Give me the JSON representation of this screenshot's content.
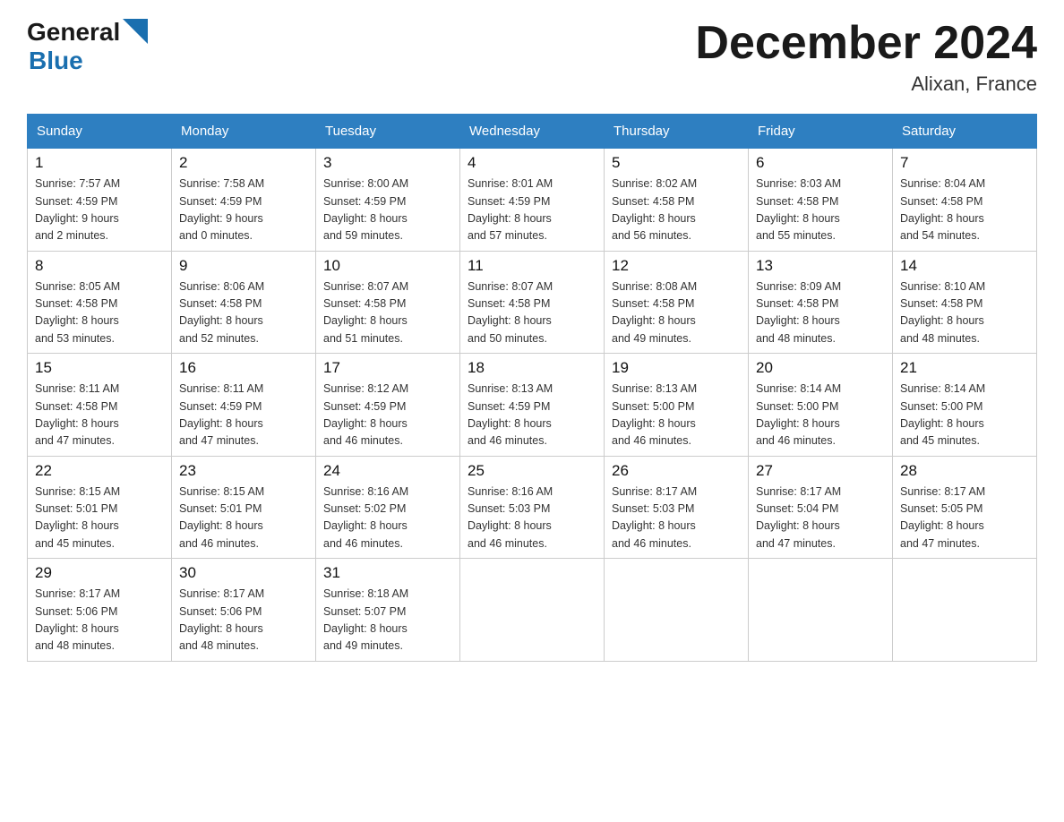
{
  "logo": {
    "general": "General",
    "blue": "Blue"
  },
  "title": "December 2024",
  "location": "Alixan, France",
  "days_of_week": [
    "Sunday",
    "Monday",
    "Tuesday",
    "Wednesday",
    "Thursday",
    "Friday",
    "Saturday"
  ],
  "weeks": [
    [
      {
        "num": "1",
        "sunrise": "7:57 AM",
        "sunset": "4:59 PM",
        "daylight": "9 hours and 2 minutes."
      },
      {
        "num": "2",
        "sunrise": "7:58 AM",
        "sunset": "4:59 PM",
        "daylight": "9 hours and 0 minutes."
      },
      {
        "num": "3",
        "sunrise": "8:00 AM",
        "sunset": "4:59 PM",
        "daylight": "8 hours and 59 minutes."
      },
      {
        "num": "4",
        "sunrise": "8:01 AM",
        "sunset": "4:59 PM",
        "daylight": "8 hours and 57 minutes."
      },
      {
        "num": "5",
        "sunrise": "8:02 AM",
        "sunset": "4:58 PM",
        "daylight": "8 hours and 56 minutes."
      },
      {
        "num": "6",
        "sunrise": "8:03 AM",
        "sunset": "4:58 PM",
        "daylight": "8 hours and 55 minutes."
      },
      {
        "num": "7",
        "sunrise": "8:04 AM",
        "sunset": "4:58 PM",
        "daylight": "8 hours and 54 minutes."
      }
    ],
    [
      {
        "num": "8",
        "sunrise": "8:05 AM",
        "sunset": "4:58 PM",
        "daylight": "8 hours and 53 minutes."
      },
      {
        "num": "9",
        "sunrise": "8:06 AM",
        "sunset": "4:58 PM",
        "daylight": "8 hours and 52 minutes."
      },
      {
        "num": "10",
        "sunrise": "8:07 AM",
        "sunset": "4:58 PM",
        "daylight": "8 hours and 51 minutes."
      },
      {
        "num": "11",
        "sunrise": "8:07 AM",
        "sunset": "4:58 PM",
        "daylight": "8 hours and 50 minutes."
      },
      {
        "num": "12",
        "sunrise": "8:08 AM",
        "sunset": "4:58 PM",
        "daylight": "8 hours and 49 minutes."
      },
      {
        "num": "13",
        "sunrise": "8:09 AM",
        "sunset": "4:58 PM",
        "daylight": "8 hours and 48 minutes."
      },
      {
        "num": "14",
        "sunrise": "8:10 AM",
        "sunset": "4:58 PM",
        "daylight": "8 hours and 48 minutes."
      }
    ],
    [
      {
        "num": "15",
        "sunrise": "8:11 AM",
        "sunset": "4:58 PM",
        "daylight": "8 hours and 47 minutes."
      },
      {
        "num": "16",
        "sunrise": "8:11 AM",
        "sunset": "4:59 PM",
        "daylight": "8 hours and 47 minutes."
      },
      {
        "num": "17",
        "sunrise": "8:12 AM",
        "sunset": "4:59 PM",
        "daylight": "8 hours and 46 minutes."
      },
      {
        "num": "18",
        "sunrise": "8:13 AM",
        "sunset": "4:59 PM",
        "daylight": "8 hours and 46 minutes."
      },
      {
        "num": "19",
        "sunrise": "8:13 AM",
        "sunset": "5:00 PM",
        "daylight": "8 hours and 46 minutes."
      },
      {
        "num": "20",
        "sunrise": "8:14 AM",
        "sunset": "5:00 PM",
        "daylight": "8 hours and 46 minutes."
      },
      {
        "num": "21",
        "sunrise": "8:14 AM",
        "sunset": "5:00 PM",
        "daylight": "8 hours and 45 minutes."
      }
    ],
    [
      {
        "num": "22",
        "sunrise": "8:15 AM",
        "sunset": "5:01 PM",
        "daylight": "8 hours and 45 minutes."
      },
      {
        "num": "23",
        "sunrise": "8:15 AM",
        "sunset": "5:01 PM",
        "daylight": "8 hours and 46 minutes."
      },
      {
        "num": "24",
        "sunrise": "8:16 AM",
        "sunset": "5:02 PM",
        "daylight": "8 hours and 46 minutes."
      },
      {
        "num": "25",
        "sunrise": "8:16 AM",
        "sunset": "5:03 PM",
        "daylight": "8 hours and 46 minutes."
      },
      {
        "num": "26",
        "sunrise": "8:17 AM",
        "sunset": "5:03 PM",
        "daylight": "8 hours and 46 minutes."
      },
      {
        "num": "27",
        "sunrise": "8:17 AM",
        "sunset": "5:04 PM",
        "daylight": "8 hours and 47 minutes."
      },
      {
        "num": "28",
        "sunrise": "8:17 AM",
        "sunset": "5:05 PM",
        "daylight": "8 hours and 47 minutes."
      }
    ],
    [
      {
        "num": "29",
        "sunrise": "8:17 AM",
        "sunset": "5:06 PM",
        "daylight": "8 hours and 48 minutes."
      },
      {
        "num": "30",
        "sunrise": "8:17 AM",
        "sunset": "5:06 PM",
        "daylight": "8 hours and 48 minutes."
      },
      {
        "num": "31",
        "sunrise": "8:18 AM",
        "sunset": "5:07 PM",
        "daylight": "8 hours and 49 minutes."
      },
      null,
      null,
      null,
      null
    ]
  ],
  "labels": {
    "sunrise": "Sunrise:",
    "sunset": "Sunset:",
    "daylight": "Daylight:"
  }
}
